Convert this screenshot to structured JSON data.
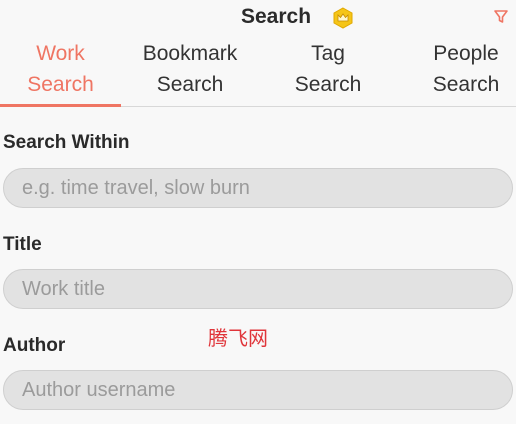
{
  "header": {
    "title": "Search",
    "badge_icon": "crown-badge-icon",
    "filter_icon": "filter-icon",
    "accent": "#ef7563"
  },
  "tabs": [
    {
      "line1": "Work",
      "line2": "Search",
      "active": true
    },
    {
      "line1": "Bookmark",
      "line2": "Search",
      "active": false
    },
    {
      "line1": "Tag",
      "line2": "Search",
      "active": false
    },
    {
      "line1": "People",
      "line2": "Search",
      "active": false
    }
  ],
  "form": {
    "search_within": {
      "label": "Search Within",
      "value": "",
      "placeholder": "e.g. time travel, slow burn"
    },
    "title": {
      "label": "Title",
      "value": "",
      "placeholder": "Work title"
    },
    "author": {
      "label": "Author",
      "value": "",
      "placeholder": "Author username"
    }
  },
  "watermark": "腾飞网"
}
